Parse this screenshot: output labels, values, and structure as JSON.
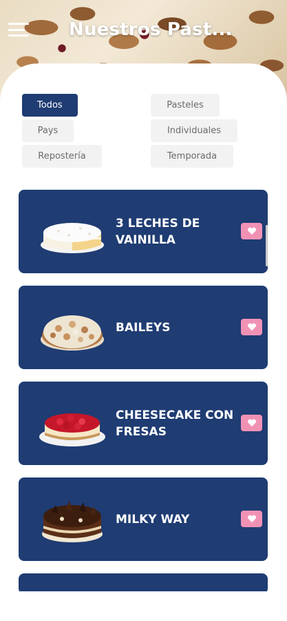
{
  "header": {
    "title": "Nuestros Past...",
    "menu_icon": "hamburger-menu-icon"
  },
  "filters": [
    {
      "label": "Todos",
      "active": true
    },
    {
      "label": "Pasteles",
      "active": false
    },
    {
      "label": "Pays",
      "active": false
    },
    {
      "label": "Individuales",
      "active": false
    },
    {
      "label": "Repostería",
      "active": false
    },
    {
      "label": "Temporada",
      "active": false
    }
  ],
  "products": [
    {
      "name": "3 LECHES DE VAINILLA",
      "image": "tres-leches-cake-image"
    },
    {
      "name": "BAILEYS",
      "image": "baileys-pie-image"
    },
    {
      "name": "CHEESECAKE CON FRESAS",
      "image": "strawberry-cheesecake-image"
    },
    {
      "name": "MILKY WAY",
      "image": "milky-way-cake-image"
    }
  ],
  "favorite_icon": "heart-icon",
  "colors": {
    "primary": "#1f3c73",
    "favorite": "#f192b5",
    "chip_bg": "#f2f2f2",
    "chip_text": "#6b6b6b"
  }
}
